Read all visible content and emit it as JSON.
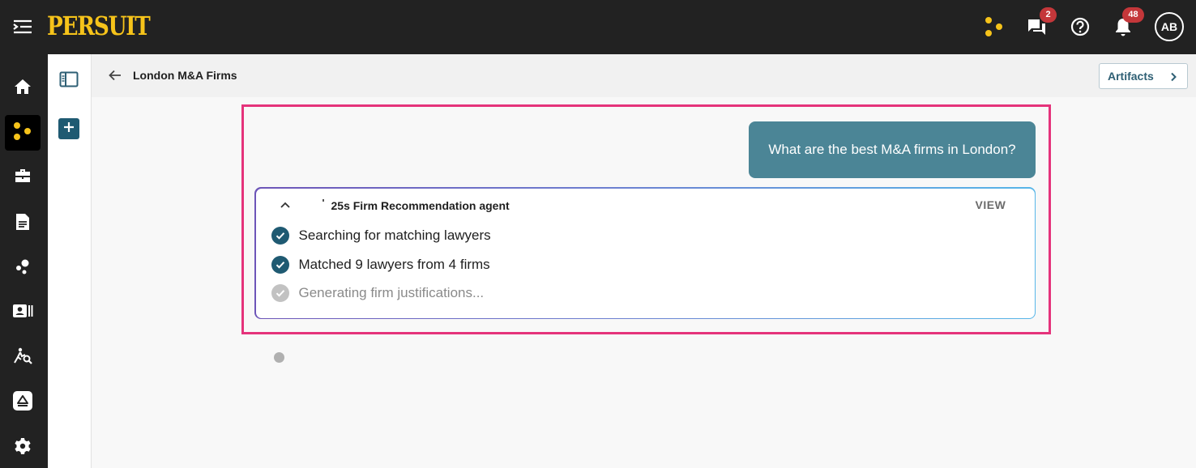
{
  "app": {
    "logo_text": "PERSUIT"
  },
  "topbar": {
    "chat_badge": "2",
    "notification_badge": "48",
    "avatar_initials": "AB"
  },
  "header": {
    "title": "London M&A Firms",
    "artifacts_label": "Artifacts"
  },
  "conversation": {
    "user_message": "What are the best M&A firms in London?",
    "agent": {
      "title": "25s Firm Recommendation agent",
      "view_label": "VIEW",
      "steps": [
        {
          "label": "Searching for matching lawyers",
          "status": "done"
        },
        {
          "label": "Matched 9 lawyers from 4 firms",
          "status": "done"
        },
        {
          "label": "Generating firm justifications...",
          "status": "pending"
        }
      ]
    }
  },
  "colors": {
    "topbar_bg": "#222222",
    "brand_yellow": "#f6c31a",
    "user_bubble": "#4b8596",
    "check_done": "#1f5a72",
    "check_pending": "#c2c2c2",
    "highlight_border": "#e5337b",
    "badge_red": "#c4373a"
  },
  "icons": [
    "menu-toggle-icon",
    "persuit-dots-icon",
    "chat-icon",
    "help-icon",
    "bell-icon",
    "home-icon",
    "briefcase-icon",
    "document-icon",
    "cluster-icon",
    "contacts-icon",
    "search-analysis-icon",
    "upload-icon",
    "settings-icon",
    "sidebar-panel-icon",
    "add-icon",
    "back-arrow-icon",
    "chevron-right-icon",
    "chevron-up-icon",
    "check-circle-icon"
  ]
}
